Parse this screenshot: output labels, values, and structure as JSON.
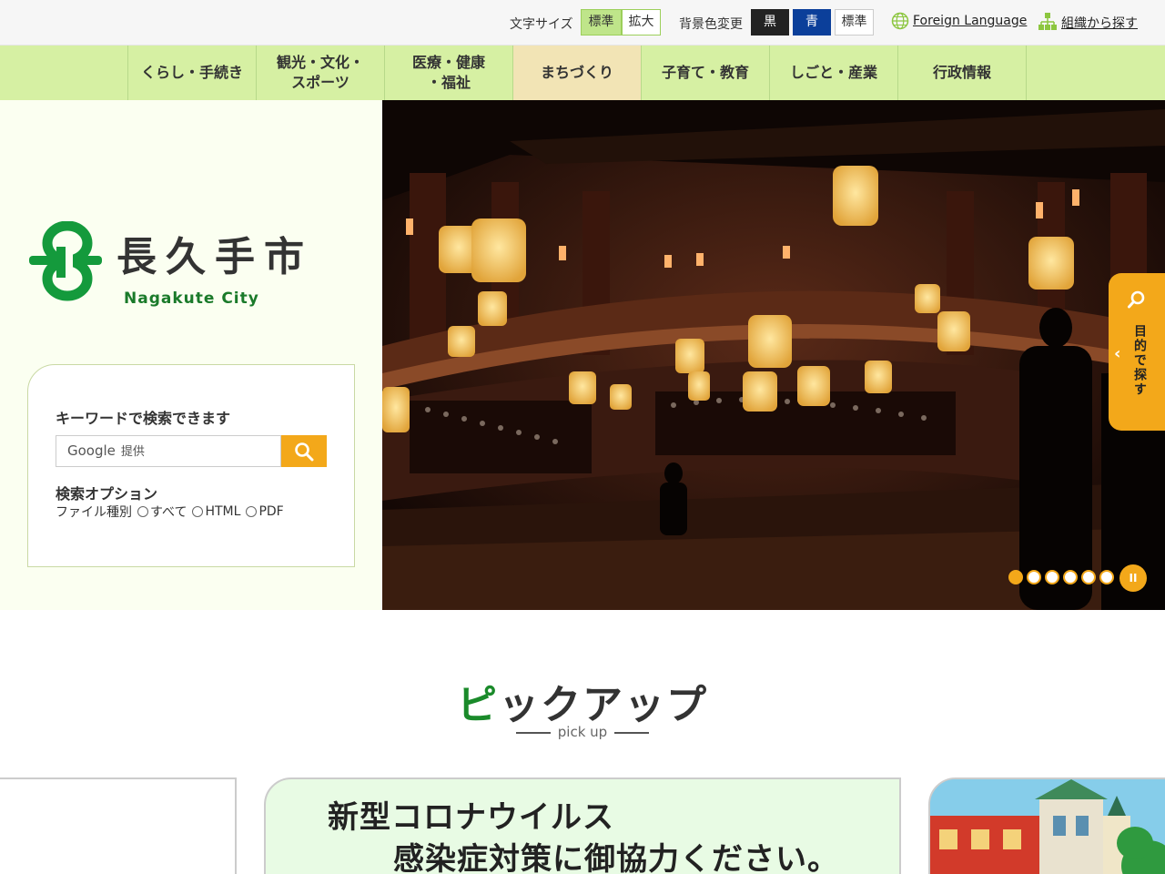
{
  "util": {
    "font_size_label": "文字サイズ",
    "font_std": "標準",
    "font_large": "拡大",
    "bg_label": "背景色変更",
    "bg_black": "黒",
    "bg_blue": "青",
    "bg_std": "標準",
    "foreign": "Foreign Language",
    "org": "組織から探す"
  },
  "nav": {
    "items": [
      {
        "label": "くらし・手続き"
      },
      {
        "label": "観光・文化・\nスポーツ"
      },
      {
        "label": "医療・健康\n・福祉"
      },
      {
        "label": "まちづくり"
      },
      {
        "label": "子育て・教育"
      },
      {
        "label": "しごと・産業"
      },
      {
        "label": "行政情報"
      }
    ]
  },
  "logo": {
    "name": "長久手市",
    "sub": "Nagakute City"
  },
  "search": {
    "title": "キーワードで検索できます",
    "google": "Google",
    "provided": "提供",
    "options_title": "検索オプション",
    "file_type_label": "ファイル種別",
    "opt_all": "すべて",
    "opt_html": "HTML",
    "opt_pdf": "PDF"
  },
  "side_tab": {
    "label": "目的で探す"
  },
  "slider": {
    "total": 6,
    "active": 1,
    "pause": "II"
  },
  "pickup": {
    "title_first": "ピ",
    "title_rest": "ックアップ",
    "subtitle": "pick up"
  },
  "banner": {
    "line1": "新型コロナウイルス",
    "line2": "感染症対策に御協力ください。"
  },
  "colors": {
    "nav_bg": "#d6f0a3",
    "accent": "#f3a81a",
    "brand_green": "#1a8a2a"
  }
}
